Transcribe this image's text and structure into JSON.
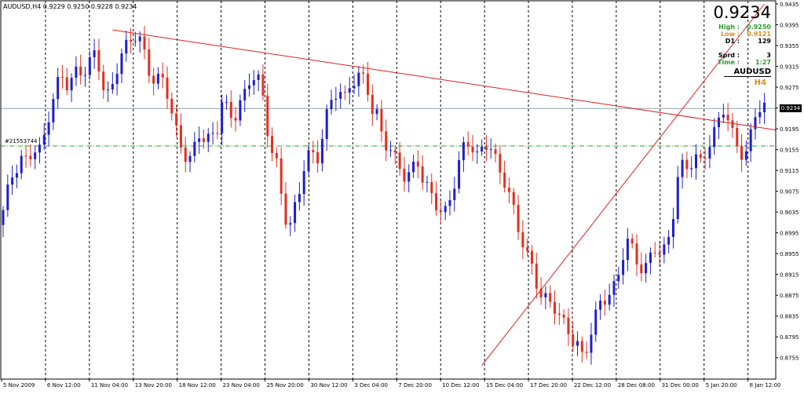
{
  "header": {
    "title": "AUDUSD,H4  0.9229 0.9250 0.9228 0.9234"
  },
  "info_panel": {
    "price": "0.9234",
    "high_label": "High :",
    "high_value": "0.9250",
    "low_label": "Low :",
    "low_value": "0.9121",
    "d1_label": "D1 :",
    "d1_value": "129",
    "sprd_label": "Sprd :",
    "sprd_value": "3",
    "time_label": "Time :",
    "time_value": "1:27",
    "symbol": "AUDUSD",
    "timeframe": "H4"
  },
  "hline_label": "#21553744",
  "current_price_tag": "0.9234",
  "colors": {
    "bull": "#1f1fc8",
    "bear": "#e03020",
    "trendline": "#e02020",
    "hline": "#8fa4a8",
    "support": "#30a030",
    "grid": "#000000",
    "high": "#2a9a2a",
    "low": "#e08a1a",
    "d1": "#000000",
    "time": "#2a9a2a",
    "tf": "#e08a1a"
  },
  "chart_data": {
    "type": "candlestick",
    "symbol": "AUDUSD",
    "timeframe": "H4",
    "ylim": [
      0.8735,
      0.9435
    ],
    "y_ticks": [
      "0.9435",
      "0.9395",
      "0.9355",
      "0.9315",
      "0.9275",
      "0.9235",
      "0.9195",
      "0.9155",
      "0.9115",
      "0.9075",
      "0.9035",
      "0.8995",
      "0.8955",
      "0.8915",
      "0.8875",
      "0.8835",
      "0.8795",
      "0.8755"
    ],
    "x_labels": [
      "5 Nov 2009",
      "6 Nov 12:00",
      "11 Nov 04:00",
      "13 Nov 20:00",
      "18 Nov 12:00",
      "23 Nov 04:00",
      "25 Nov 20:00",
      "30 Nov 12:00",
      "3 Dec 04:00",
      "7 Dec 20:00",
      "10 Dec 12:00",
      "15 Dec 04:00",
      "17 Dec 20:00",
      "22 Dec 12:00",
      "28 Dec 08:00",
      "31 Dec 00:00",
      "5 Jan 20:00",
      "8 Jan 12:00"
    ],
    "grid_dashed_vertical": true,
    "horizontal_lines": [
      {
        "name": "current price",
        "price": 0.9234
      },
      {
        "name": "#21553744",
        "price": 0.9162
      }
    ],
    "trendlines": [
      {
        "name": "resistance",
        "start": {
          "bar": 24,
          "price": 0.9385
        },
        "end": {
          "bar": 167,
          "price": 0.9196
        }
      },
      {
        "name": "support",
        "start": {
          "bar": 105,
          "price": 0.874
        },
        "end": {
          "bar": 167,
          "price": 0.9435
        }
      }
    ],
    "close_path": [
      [
        0,
        0.901
      ],
      [
        1,
        0.906
      ],
      [
        2,
        0.91
      ],
      [
        3,
        0.912
      ],
      [
        4,
        0.914
      ],
      [
        5,
        0.913
      ],
      [
        6,
        0.916
      ],
      [
        7,
        0.915
      ],
      [
        8,
        0.918
      ],
      [
        9,
        0.923
      ],
      [
        10,
        0.927
      ],
      [
        11,
        0.93
      ],
      [
        12,
        0.928
      ],
      [
        13,
        0.929
      ],
      [
        14,
        0.931
      ],
      [
        15,
        0.93
      ],
      [
        16,
        0.932
      ],
      [
        17,
        0.934
      ],
      [
        18,
        0.931
      ],
      [
        19,
        0.925
      ],
      [
        20,
        0.927
      ],
      [
        21,
        0.931
      ],
      [
        22,
        0.934
      ],
      [
        23,
        0.936
      ],
      [
        24,
        0.9375
      ],
      [
        25,
        0.937
      ],
      [
        26,
        0.934
      ],
      [
        27,
        0.93
      ],
      [
        28,
        0.928
      ],
      [
        29,
        0.93
      ],
      [
        30,
        0.927
      ],
      [
        31,
        0.922
      ],
      [
        32,
        0.918
      ],
      [
        33,
        0.915
      ],
      [
        34,
        0.913
      ],
      [
        35,
        0.916
      ],
      [
        36,
        0.919
      ],
      [
        37,
        0.917
      ],
      [
        38,
        0.918
      ],
      [
        39,
        0.919
      ],
      [
        40,
        0.925
      ],
      [
        41,
        0.923
      ],
      [
        42,
        0.921
      ],
      [
        43,
        0.924
      ],
      [
        44,
        0.926
      ],
      [
        45,
        0.929
      ],
      [
        46,
        0.93
      ],
      [
        47,
        0.928
      ],
      [
        48,
        0.92
      ],
      [
        49,
        0.915
      ],
      [
        50,
        0.912
      ],
      [
        51,
        0.904
      ],
      [
        52,
        0.9
      ],
      [
        53,
        0.904
      ],
      [
        54,
        0.908
      ],
      [
        55,
        0.914
      ],
      [
        56,
        0.915
      ],
      [
        57,
        0.913
      ],
      [
        58,
        0.918
      ],
      [
        59,
        0.923
      ],
      [
        60,
        0.926
      ],
      [
        61,
        0.927
      ],
      [
        62,
        0.925
      ],
      [
        63,
        0.928
      ],
      [
        64,
        0.929
      ],
      [
        65,
        0.93
      ],
      [
        66,
        0.928
      ],
      [
        67,
        0.923
      ],
      [
        68,
        0.922
      ],
      [
        69,
        0.917
      ],
      [
        70,
        0.916
      ],
      [
        71,
        0.914
      ],
      [
        72,
        0.912
      ],
      [
        73,
        0.91
      ],
      [
        74,
        0.911
      ],
      [
        75,
        0.914
      ],
      [
        76,
        0.91
      ],
      [
        77,
        0.908
      ],
      [
        78,
        0.906
      ],
      [
        79,
        0.904
      ],
      [
        80,
        0.903
      ],
      [
        81,
        0.906
      ],
      [
        82,
        0.91
      ],
      [
        83,
        0.915
      ],
      [
        84,
        0.917
      ],
      [
        85,
        0.916
      ],
      [
        86,
        0.914
      ],
      [
        87,
        0.916
      ],
      [
        88,
        0.917
      ],
      [
        89,
        0.914
      ],
      [
        90,
        0.911
      ],
      [
        91,
        0.909
      ],
      [
        92,
        0.906
      ],
      [
        93,
        0.901
      ],
      [
        94,
        0.898
      ],
      [
        95,
        0.895
      ],
      [
        96,
        0.892
      ],
      [
        97,
        0.888
      ],
      [
        98,
        0.887
      ],
      [
        99,
        0.886
      ],
      [
        100,
        0.885
      ],
      [
        101,
        0.883
      ],
      [
        102,
        0.881
      ],
      [
        103,
        0.879
      ],
      [
        104,
        0.878
      ],
      [
        105,
        0.875
      ],
      [
        106,
        0.879
      ],
      [
        107,
        0.883
      ],
      [
        108,
        0.886
      ],
      [
        109,
        0.887
      ],
      [
        110,
        0.888
      ],
      [
        111,
        0.89
      ],
      [
        112,
        0.895
      ],
      [
        113,
        0.898
      ],
      [
        114,
        0.896
      ],
      [
        115,
        0.893
      ],
      [
        116,
        0.892
      ],
      [
        117,
        0.895
      ],
      [
        118,
        0.897
      ],
      [
        119,
        0.895
      ],
      [
        120,
        0.897
      ],
      [
        121,
        0.902
      ],
      [
        122,
        0.91
      ],
      [
        123,
        0.913
      ],
      [
        124,
        0.912
      ],
      [
        125,
        0.914
      ],
      [
        126,
        0.913
      ],
      [
        127,
        0.915
      ],
      [
        128,
        0.917
      ],
      [
        129,
        0.92
      ],
      [
        130,
        0.924
      ],
      [
        131,
        0.921
      ],
      [
        132,
        0.918
      ],
      [
        133,
        0.916
      ],
      [
        134,
        0.913
      ],
      [
        135,
        0.918
      ],
      [
        136,
        0.923
      ],
      [
        137,
        0.9234
      ]
    ]
  }
}
